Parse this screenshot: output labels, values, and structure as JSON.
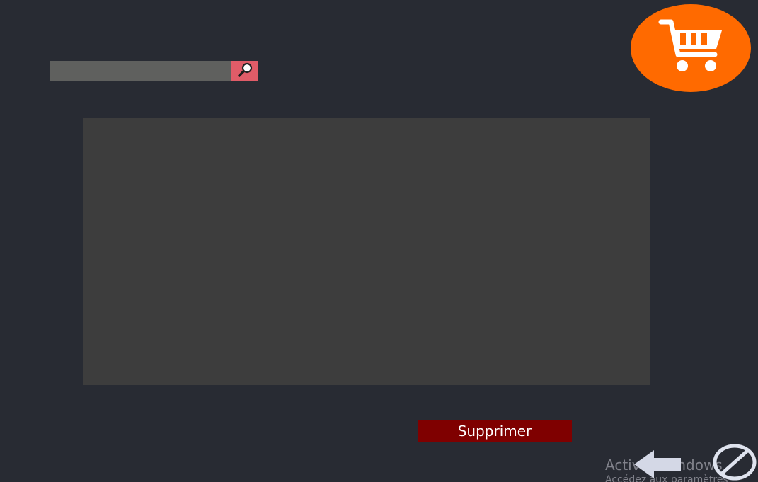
{
  "search": {
    "value": "",
    "placeholder": "",
    "button_icon": "search-icon",
    "button_color": "#e05c68"
  },
  "cart": {
    "icon": "shopping-cart-icon",
    "color": "#ff6a00"
  },
  "table": {
    "rows": []
  },
  "actions": {
    "delete_label": "Supprimer",
    "delete_color": "#7f0000",
    "back_icon": "arrow-left-icon",
    "cancel_icon": "cancel-icon"
  },
  "watermark": {
    "line1": "Activer Windows",
    "line2": "Accédez aux paramètres"
  },
  "colors": {
    "background": "#282b33",
    "panel": "#3d3d3d"
  }
}
